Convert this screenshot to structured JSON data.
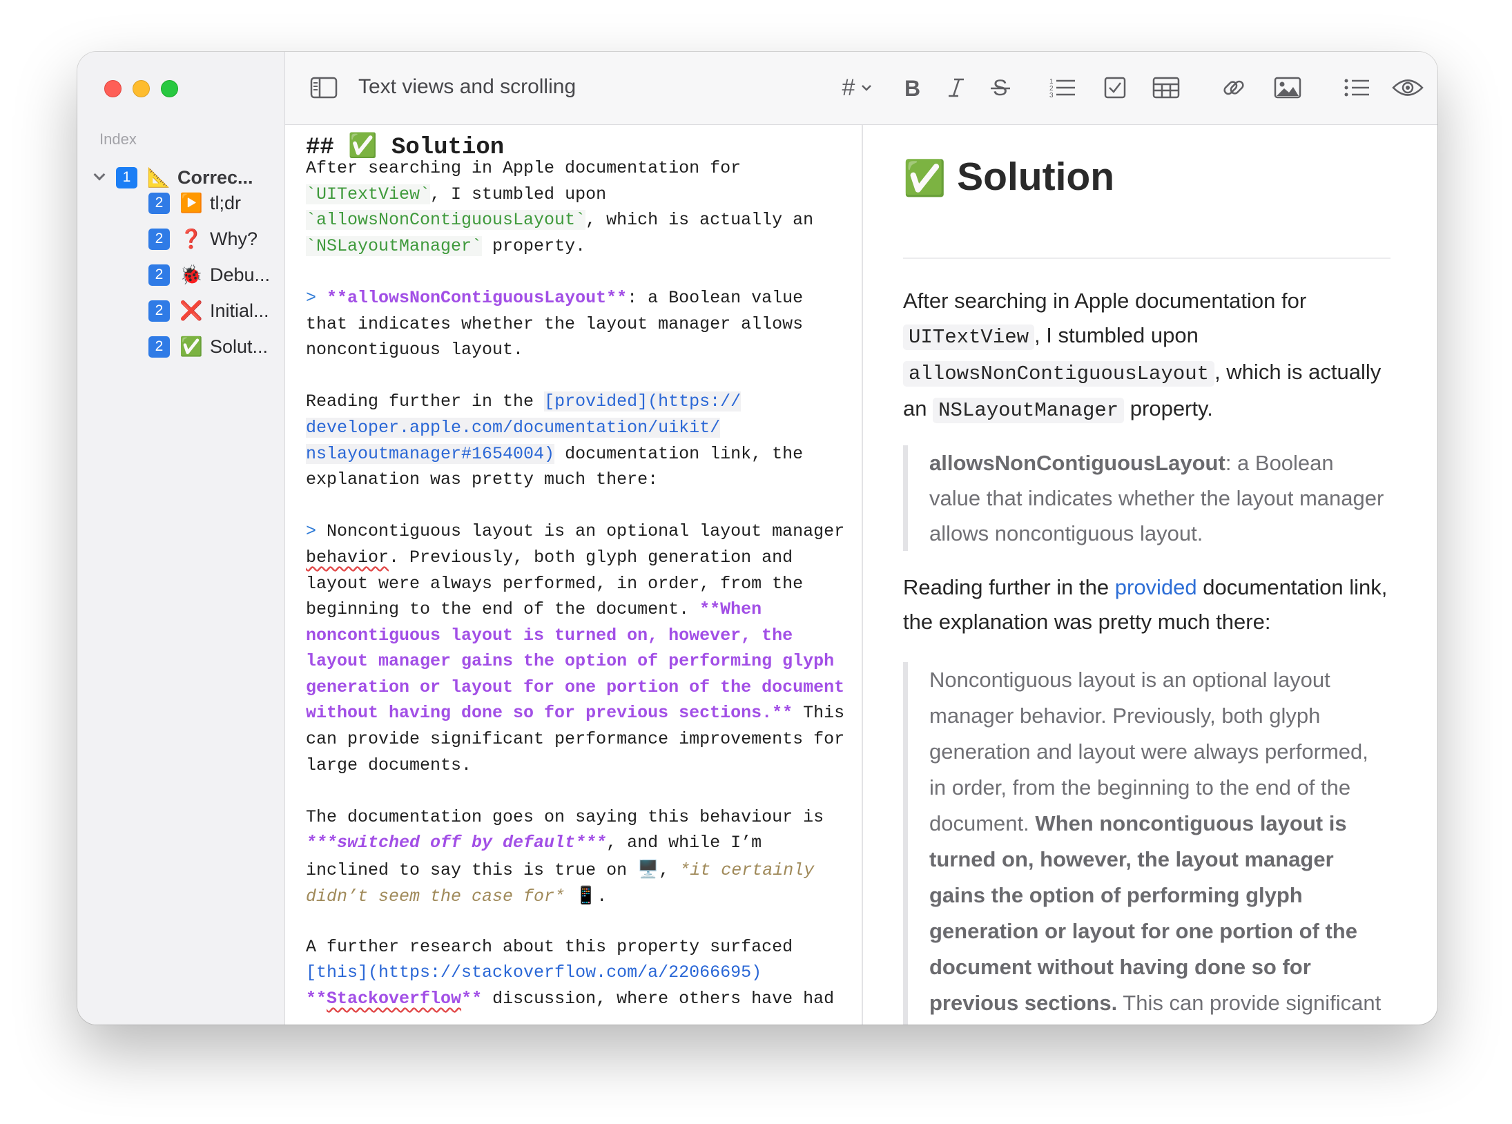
{
  "sidebar": {
    "heading": "Index",
    "items": [
      {
        "level": "1",
        "emoji": "📐",
        "label": "Correc..."
      },
      {
        "level": "2",
        "emoji": "▶️",
        "label": "tl;dr"
      },
      {
        "level": "2",
        "emoji": "❓",
        "label": "Why?"
      },
      {
        "level": "2",
        "emoji": "🐞",
        "label": "Debu..."
      },
      {
        "level": "2",
        "emoji": "❌",
        "label": "Initial..."
      },
      {
        "level": "2",
        "emoji": "✅",
        "label": "Solut..."
      }
    ]
  },
  "toolbar": {
    "title": "Text views and scrolling",
    "heading_icon": "#"
  },
  "editor": {
    "h2_marker": "## ",
    "h2_emoji": "✅",
    "h2_text": " Solution",
    "p1": {
      "l1": "After searching in Apple documentation for",
      "code1": "`UITextView`",
      "l2b": ", I stumbled upon",
      "code2": "`allowsNonContiguousLayout`",
      "l3b": ", which is actually an",
      "code3": "`NSLayoutManager`",
      "l4b": " property."
    },
    "bq1": {
      "mark": "> ",
      "bold": "**allowsNonContiguousLayout**",
      "l1b": ": a Boolean value",
      "l2": "that indicates whether the layout manager allows",
      "l3": "noncontiguous layout."
    },
    "p2": {
      "l1a": "Reading further in the ",
      "link1": "[provided](https://",
      "link2": "developer.apple.com/documentation/uikit/",
      "link3": "nslayoutmanager#1654004)",
      "l3b": " documentation link, the",
      "l4": "explanation was pretty much there:"
    },
    "bq2": {
      "mark": "> ",
      "l1b": "Noncontiguous layout is an optional layout manager",
      "l2a": "behavior",
      "l2b": ". Previously, both glyph generation and",
      "l3": "layout were always performed, in order, from the",
      "l4a": "beginning to the end of the document. ",
      "b1": "**When",
      "b2": "noncontiguous layout is turned on, however, the",
      "b3": "layout manager gains the option of performing glyph",
      "b4": "generation or layout for one portion of the document",
      "b5": "without having done so for previous sections.**",
      "l8b": " This",
      "l9": "can provide significant performance improvements for",
      "l10": "large documents."
    },
    "p3": {
      "l1": "The documentation goes on saying this behaviour is",
      "bi": "***switched off by default***",
      "l2b": ", and while I’m",
      "l3a": "inclined to say this is true on ",
      "emoji1": "🖥️",
      "l3b": ", ",
      "it1": "*it certainly",
      "it2": "didn’t seem the case for*",
      "l4b": " ",
      "emoji2": "📱",
      "l4c": "."
    },
    "p4": {
      "l1": "A further research about this property surfaced",
      "link": "[this](https://stackoverflow.com/a/22066695)",
      "b1": "**",
      "b2": "Stackoverflow",
      "b3": "**",
      "l3b": " discussion, where others have had"
    }
  },
  "preview": {
    "h2_emoji": "✅",
    "h2_text": "Solution",
    "p1": {
      "a": "After searching in Apple documentation for ",
      "code1": "UITextView",
      "b": ", I stumbled upon ",
      "code2": "allowsNonContiguousLayout",
      "c": ", which is actually an ",
      "code3": "NSLayoutManager",
      "d": " property."
    },
    "bq1": {
      "bold": "allowsNonContiguousLayout",
      "rest": ": a Boolean value that indicates whether the layout manager allows noncontiguous layout."
    },
    "p2": {
      "a": "Reading further in the ",
      "link": "provided",
      "b": " documentation link, the explanation was pretty much there:"
    },
    "bq2": {
      "a": "Noncontiguous layout is an optional layout manager behavior. Previously, both glyph generation and layout were always performed, in order, from the beginning to the end of the document. ",
      "bold": "When noncontiguous layout is turned on, however, the layout manager gains the option of performing glyph generation or layout for one portion of the document without having done so for previous sections.",
      "b": " This can provide significant performance improvements for large documents."
    }
  }
}
